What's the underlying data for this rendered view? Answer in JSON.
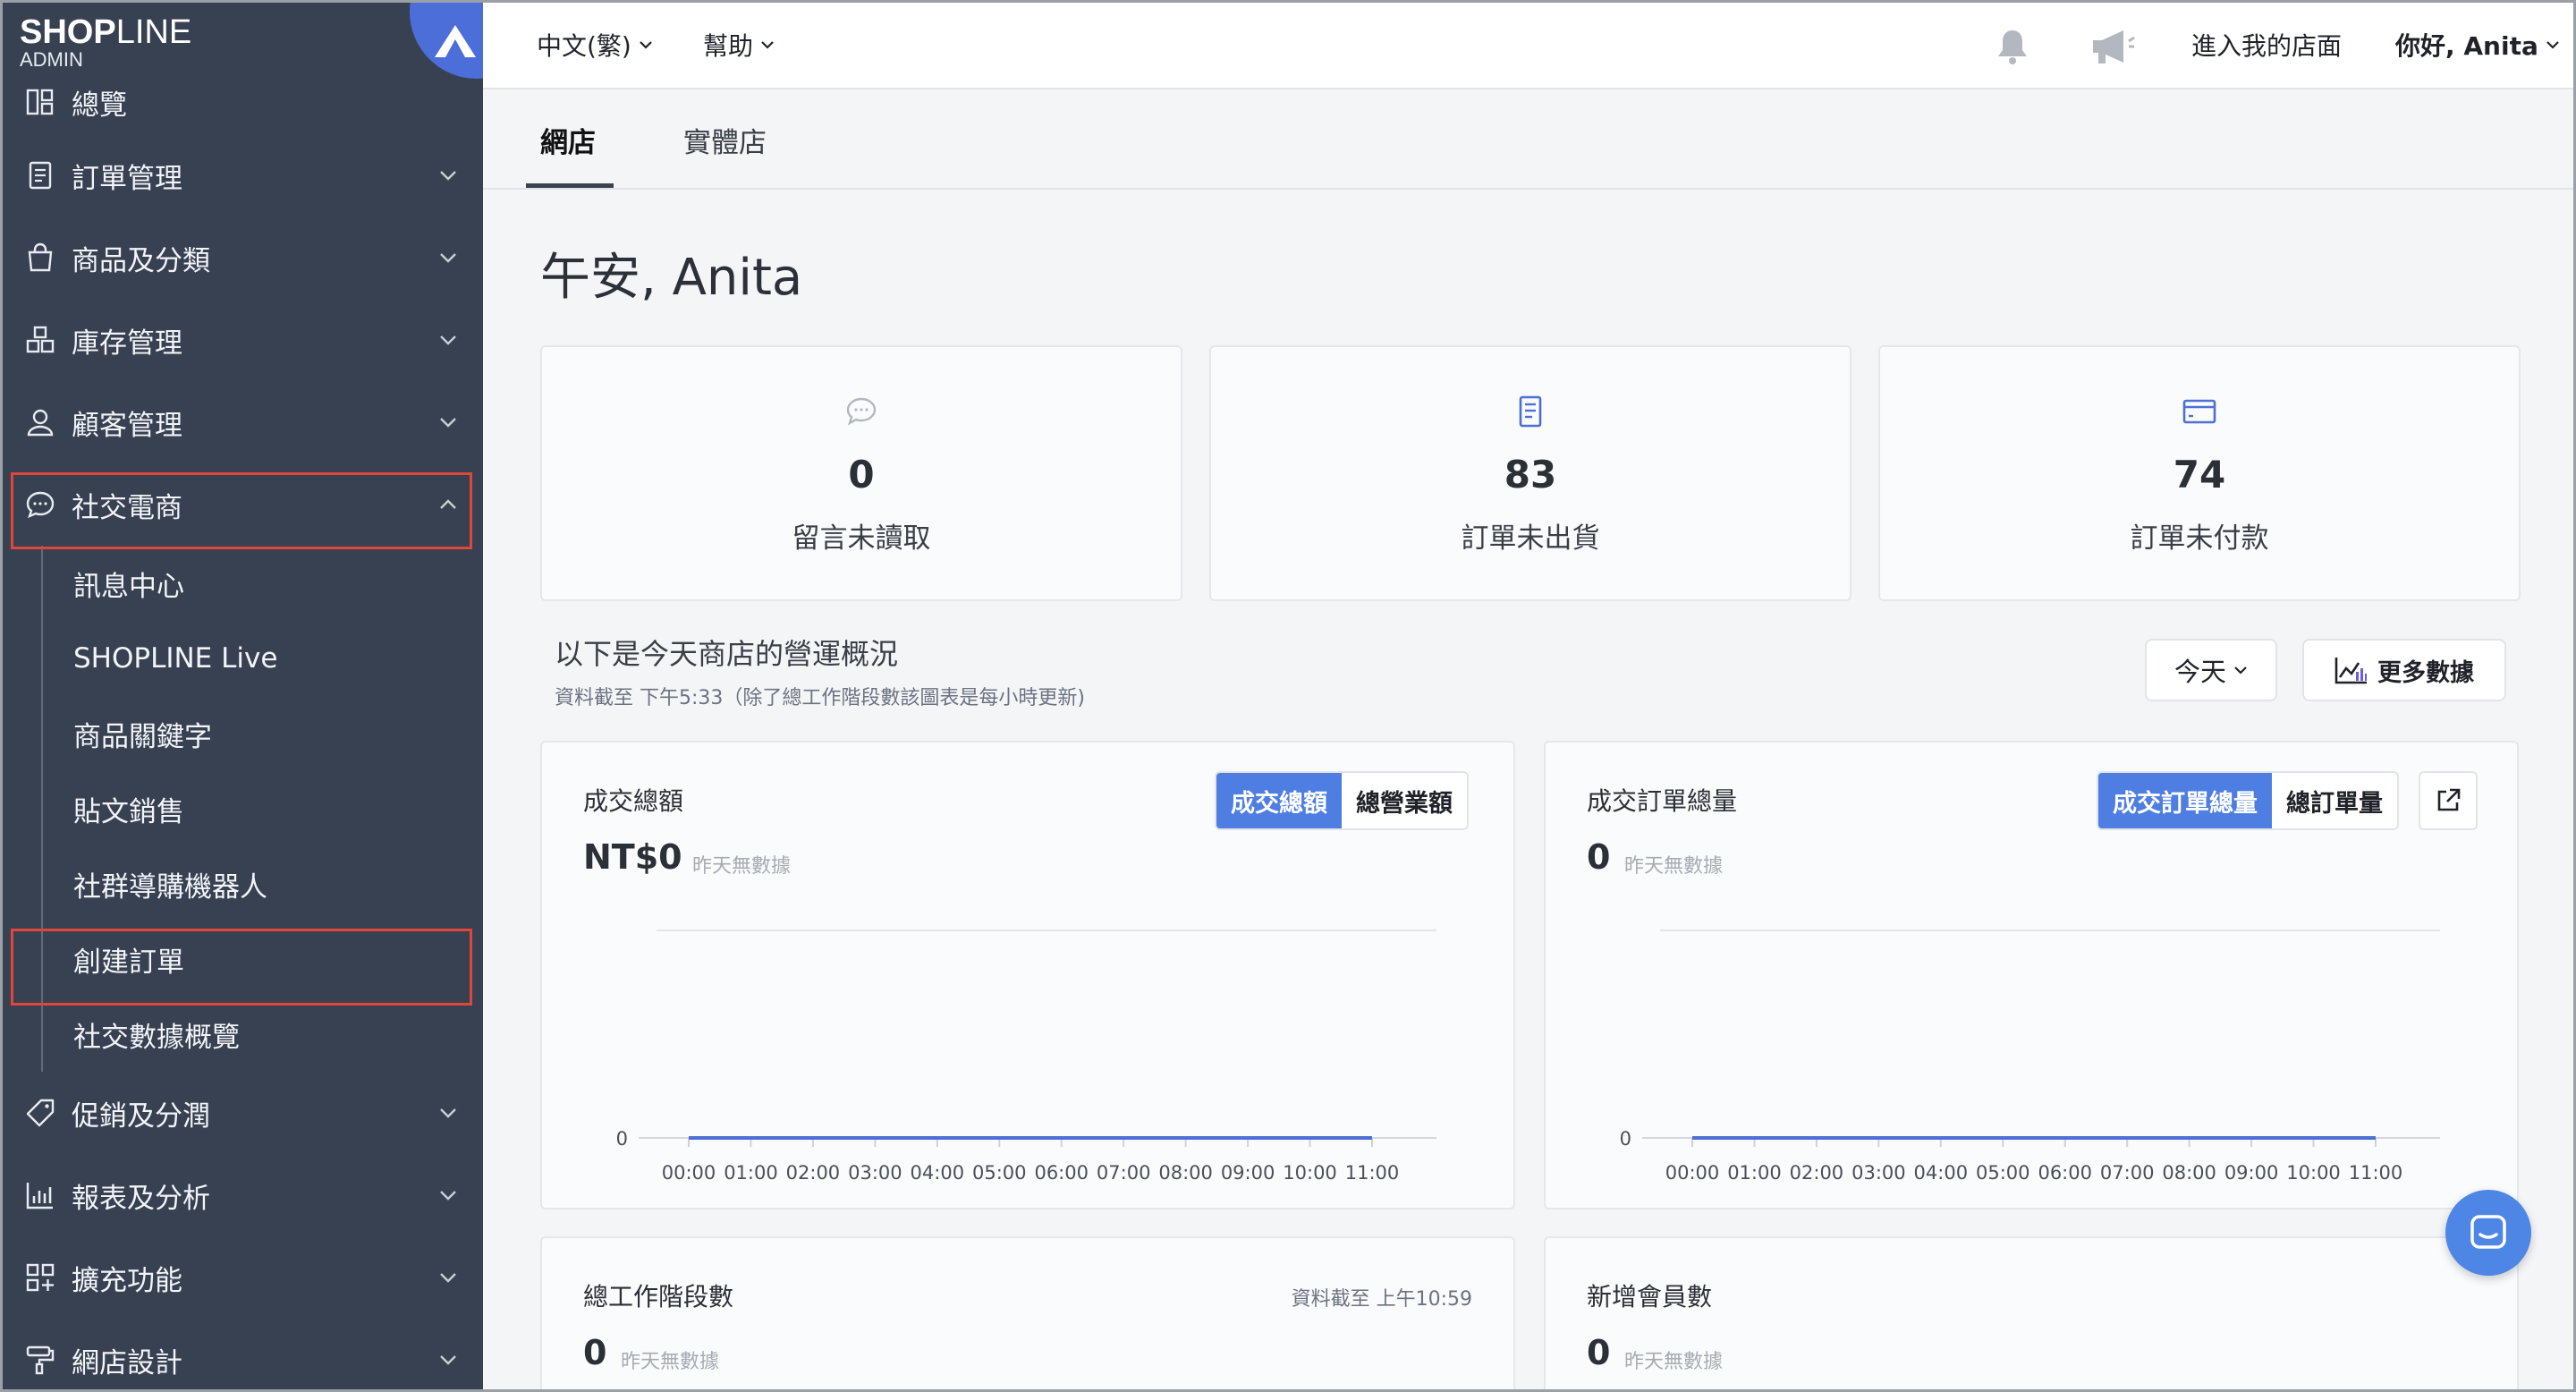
{
  "brand": {
    "logo_bold": "SHOP",
    "logo_thin": "LINE",
    "admin": "ADMIN"
  },
  "sidebar": {
    "items": [
      {
        "label": "總覽",
        "icon": "dashboard-icon"
      },
      {
        "label": "訂單管理",
        "icon": "order-icon"
      },
      {
        "label": "商品及分類",
        "icon": "shopping-bag-icon"
      },
      {
        "label": "庫存管理",
        "icon": "inventory-icon"
      },
      {
        "label": "顧客管理",
        "icon": "customer-icon"
      },
      {
        "label": "社交電商",
        "icon": "chat-bubble-icon"
      }
    ],
    "sub_items": [
      "訊息中心",
      "SHOPLINE Live",
      "商品關鍵字",
      "貼文銷售",
      "社群導購機器人",
      "創建訂單",
      "社交數據概覽"
    ],
    "items_after": [
      {
        "label": "促銷及分潤",
        "icon": "tag-icon"
      },
      {
        "label": "報表及分析",
        "icon": "report-icon"
      },
      {
        "label": "擴充功能",
        "icon": "apps-icon"
      },
      {
        "label": "網店設計",
        "icon": "paint-roller-icon"
      }
    ]
  },
  "topbar": {
    "language": "中文(繁)",
    "help": "幫助",
    "enter_store": "進入我的店面",
    "greeting_user": "你好, Anita"
  },
  "tabs": [
    {
      "label": "網店",
      "active": true
    },
    {
      "label": "實體店",
      "active": false
    }
  ],
  "page": {
    "greeting": "午安, Anita"
  },
  "stats": [
    {
      "value": "0",
      "label": "留言未讀取",
      "icon": "comment-icon"
    },
    {
      "value": "83",
      "label": "訂單未出貨",
      "icon": "order-doc-icon"
    },
    {
      "value": "74",
      "label": "訂單未付款",
      "icon": "credit-card-icon"
    }
  ],
  "overview": {
    "title": "以下是今天商店的營運概況",
    "subtitle": "資料截至 下午5:33（除了總工作階段數該圖表是每小時更新)",
    "period": "今天",
    "more_data": "更多數據"
  },
  "cards": {
    "sales": {
      "title": "成交總額",
      "value": "NT$0",
      "note": "昨天無數據",
      "toggle": [
        "成交總額",
        "總營業額"
      ],
      "y_zero": "0"
    },
    "orders": {
      "title": "成交訂單總量",
      "value": "0",
      "note": "昨天無數據",
      "toggle": [
        "成交訂單總量",
        "總訂單量"
      ],
      "y_zero": "0"
    },
    "sessions": {
      "title": "總工作階段數",
      "value": "0",
      "note": "昨天無數據",
      "updated": "資料截至 上午10:59"
    },
    "members": {
      "title": "新增會員數",
      "value": "0",
      "note": "昨天無數據"
    }
  },
  "chart_data": [
    {
      "type": "line",
      "title": "成交總額",
      "x": [
        "00:00",
        "01:00",
        "02:00",
        "03:00",
        "04:00",
        "05:00",
        "06:00",
        "07:00",
        "08:00",
        "09:00",
        "10:00",
        "11:00"
      ],
      "series": [
        {
          "values": [
            0,
            0,
            0,
            0,
            0,
            0,
            0,
            0,
            0,
            0,
            0,
            0
          ]
        }
      ],
      "yticks": [
        "0"
      ],
      "color": "#4e6fd6"
    },
    {
      "type": "line",
      "title": "成交訂單總量",
      "x": [
        "00:00",
        "01:00",
        "02:00",
        "03:00",
        "04:00",
        "05:00",
        "06:00",
        "07:00",
        "08:00",
        "09:00",
        "10:00",
        "11:00"
      ],
      "series": [
        {
          "values": [
            0,
            0,
            0,
            0,
            0,
            0,
            0,
            0,
            0,
            0,
            0,
            0
          ]
        }
      ],
      "yticks": [
        "0"
      ],
      "color": "#4e6fd6"
    }
  ],
  "colors": {
    "sidebar_bg": "#384152",
    "accent": "#4e7ee2",
    "highlight_border": "#e0463a"
  }
}
